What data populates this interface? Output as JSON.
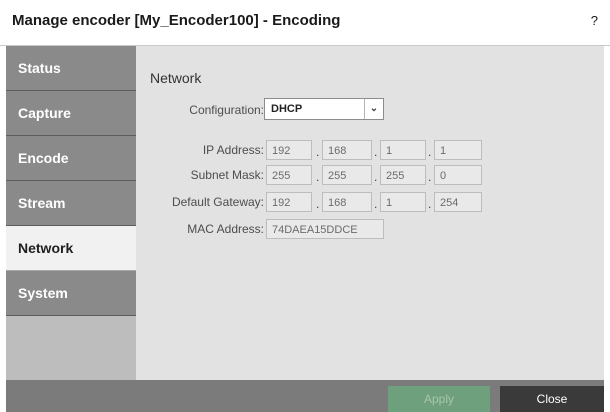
{
  "window": {
    "title": "Manage encoder [My_Encoder100] - Encoding",
    "help": "?"
  },
  "sidebar": {
    "items": [
      {
        "label": "Status"
      },
      {
        "label": "Capture"
      },
      {
        "label": "Encode"
      },
      {
        "label": "Stream"
      },
      {
        "label": "Network",
        "active": true
      },
      {
        "label": "System"
      }
    ]
  },
  "network": {
    "heading": "Network",
    "configuration": {
      "label": "Configuration:",
      "value": "DHCP"
    },
    "ip": {
      "label": "IP Address:",
      "octets": [
        "192",
        "168",
        "1",
        "1"
      ]
    },
    "subnet": {
      "label": "Subnet Mask:",
      "octets": [
        "255",
        "255",
        "255",
        "0"
      ]
    },
    "gateway": {
      "label": "Default Gateway:",
      "octets": [
        "192",
        "168",
        "1",
        "254"
      ]
    },
    "mac": {
      "label": "MAC Address:",
      "value": "74DAEA15DDCE"
    },
    "dot": "."
  },
  "footer": {
    "apply": "Apply",
    "close": "Close"
  },
  "colors": {
    "sidebar": "#8a8a8a",
    "active_tab": "#f1f1f1",
    "apply": "#6fa07d",
    "close": "#3a3a3a"
  }
}
